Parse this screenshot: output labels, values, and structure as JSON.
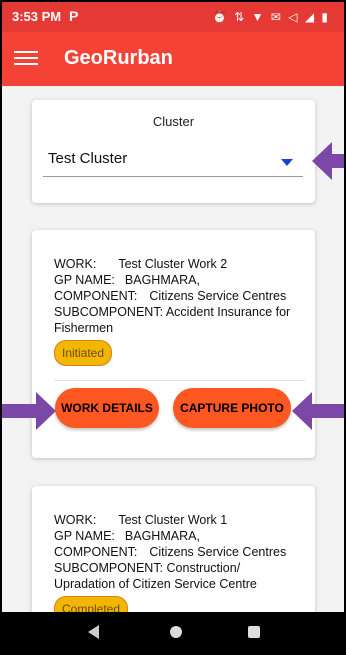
{
  "status_bar": {
    "time": "3:53 PM",
    "app_icon": "P",
    "icons": "⏰ ⇅ ▼ ✉ ◁ ◢ ▮"
  },
  "app_bar": {
    "title": "GeoRurban"
  },
  "cluster_card": {
    "label": "Cluster",
    "selected_value": "Test Cluster"
  },
  "work_items": [
    {
      "work_label": "WORK:",
      "work_value": "Test Cluster Work 2",
      "gp_label": "GP NAME:",
      "gp_value": "BAGHMARA,",
      "component_label": "COMPONENT:",
      "component_value": "Citizens Service Centres",
      "subcomponent_label": "SUBCOMPONENT:",
      "subcomponent_value": "Accident Insurance for Fishermen",
      "status": "Initiated",
      "details_button": "WORK DETAILS",
      "photo_button": "CAPTURE PHOTO"
    },
    {
      "work_label": "WORK:",
      "work_value": "Test Cluster Work 1",
      "gp_label": "GP NAME:",
      "gp_value": "BAGHMARA,",
      "component_label": "COMPONENT:",
      "component_value": "Citizens Service Centres",
      "subcomponent_label": "SUBCOMPONENT:",
      "subcomponent_value": "Construction/ Upradation of Citizen Service Centre",
      "status": "Completed"
    }
  ],
  "colors": {
    "app_bar": "#f44336",
    "button": "#ff5722",
    "badge": "#f2b705",
    "arrow": "#7b48a8"
  }
}
